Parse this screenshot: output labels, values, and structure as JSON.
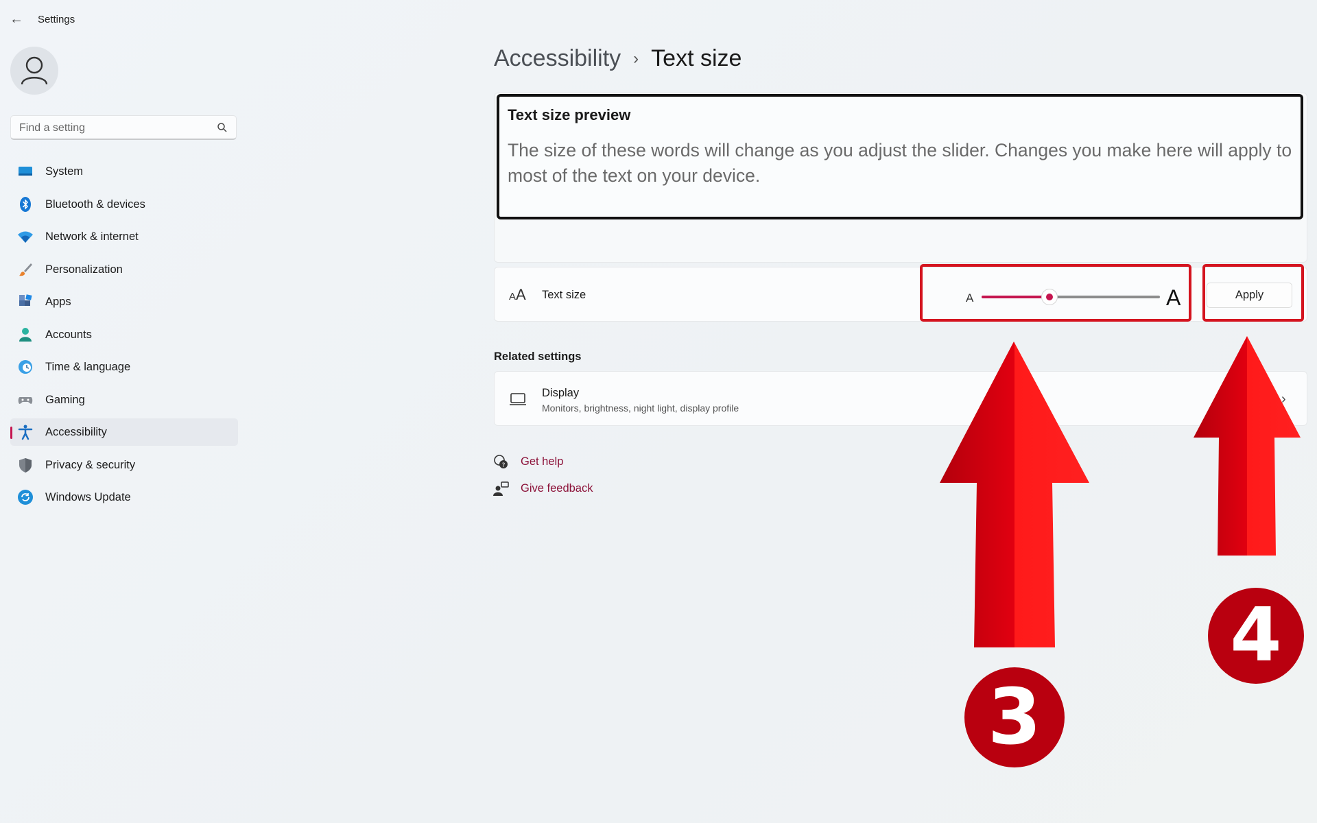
{
  "app": {
    "title": "Settings"
  },
  "sidebar": {
    "search_placeholder": "Find a setting",
    "items": [
      {
        "label": "System",
        "icon": "system-icon"
      },
      {
        "label": "Bluetooth & devices",
        "icon": "bluetooth-icon"
      },
      {
        "label": "Network & internet",
        "icon": "wifi-icon"
      },
      {
        "label": "Personalization",
        "icon": "brush-icon"
      },
      {
        "label": "Apps",
        "icon": "apps-icon"
      },
      {
        "label": "Accounts",
        "icon": "person-icon"
      },
      {
        "label": "Time & language",
        "icon": "clock-globe-icon"
      },
      {
        "label": "Gaming",
        "icon": "gamepad-icon"
      },
      {
        "label": "Accessibility",
        "icon": "accessibility-icon",
        "active": true
      },
      {
        "label": "Privacy & security",
        "icon": "shield-icon"
      },
      {
        "label": "Windows Update",
        "icon": "update-icon"
      }
    ]
  },
  "breadcrumb": {
    "parent": "Accessibility",
    "separator": "›",
    "current": "Text size"
  },
  "preview": {
    "title": "Text size preview",
    "text": "The size of these words will change as you adjust the slider. Changes you make here will apply to most of the text on your device."
  },
  "text_size": {
    "label": "Text size",
    "small_glyph": "A",
    "large_glyph": "A",
    "slider_value_fraction": 0.38,
    "apply_label": "Apply"
  },
  "related": {
    "heading": "Related settings",
    "display_title": "Display",
    "display_subtitle": "Monitors, brightness, night light, display profile"
  },
  "links": {
    "help": "Get help",
    "feedback": "Give feedback"
  },
  "annotations": {
    "step3": "3",
    "step4": "4",
    "color": "#d4141f"
  },
  "colors": {
    "accent": "#c5154f",
    "link": "#8c1239"
  }
}
